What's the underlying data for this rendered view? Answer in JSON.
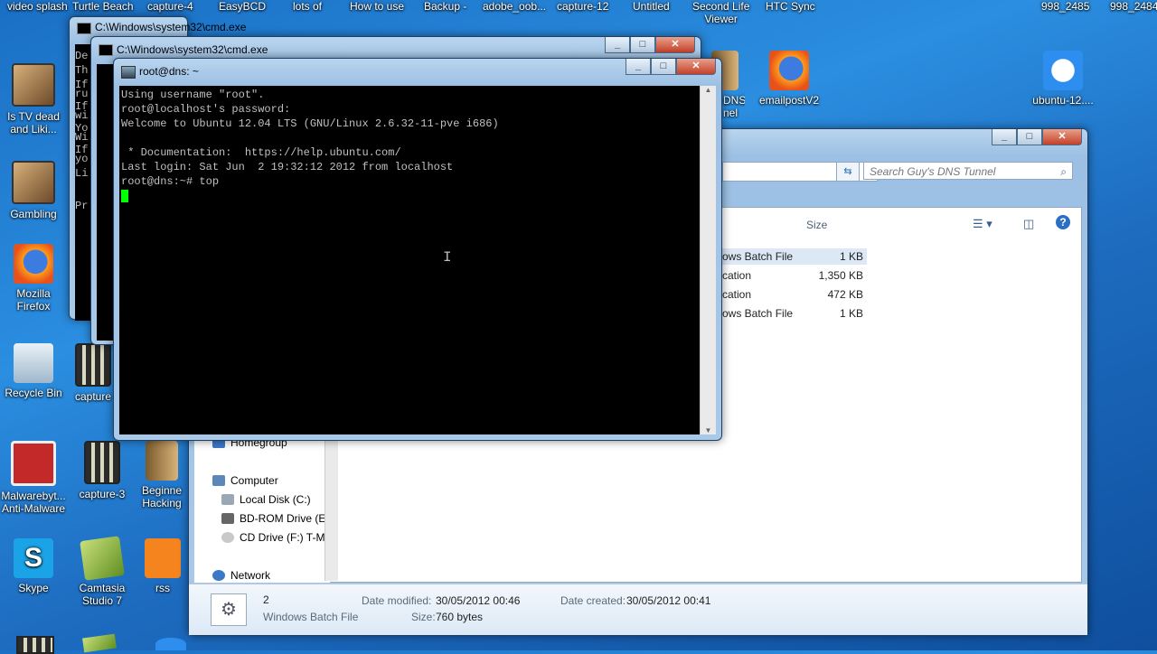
{
  "top_labels": [
    "video splash",
    "Turtle Beach",
    "capture-4",
    "EasyBCD",
    "lots of",
    "How to use",
    "Backup -",
    "adobe_oob...",
    "capture-12",
    "Untitled",
    "Second Life\nViewer",
    "HTC Sync",
    "998_2485",
    "998_2484"
  ],
  "desktop_icons": {
    "tvdead": "Is TV dead\nand Liki...",
    "gambling": "Gambling",
    "firefox": "Mozilla\nFirefox",
    "recycle": "Recycle Bin",
    "capture_a": "capture",
    "malwarebytes": "Malwarebyt...\nAnti-Malware",
    "capture3": "capture-3",
    "beginner": "Beginne\nHacking",
    "skype": "Skype",
    "camtasia": "Camtasia\nStudio 7",
    "rss": "rss",
    "dns": "DNS\nnel",
    "emailpost": "emailpostV2",
    "ubuntu": "ubuntu-12...."
  },
  "cmd_back": {
    "title": "C:\\Windows\\system32\\cmd.exe",
    "lines": [
      "De",
      "Th",
      "If\nru",
      "If\nwi",
      "Yo\nWi",
      "If\nyo",
      "Li",
      "Pr"
    ]
  },
  "cmd_mid": {
    "title": "C:\\Windows\\system32\\cmd.exe"
  },
  "putty": {
    "title": "root@dns: ~",
    "lines": [
      "Using username \"root\".",
      "root@localhost's password:",
      "Welcome to Ubuntu 12.04 LTS (GNU/Linux 2.6.32-11-pve i686)",
      "",
      " * Documentation:  https://help.ubuntu.com/",
      "Last login: Sat Jun  2 19:32:12 2012 from localhost",
      "root@dns:~# top"
    ]
  },
  "explorer": {
    "search_placeholder": "Search Guy's DNS Tunnel",
    "col_size": "Size",
    "files": [
      {
        "type": "ows Batch File",
        "size": "1 KB"
      },
      {
        "type": "cation",
        "size": "1,350 KB"
      },
      {
        "type": "cation",
        "size": "472 KB"
      },
      {
        "type": "ows Batch File",
        "size": "1 KB"
      }
    ],
    "tree": {
      "homegroup": "Homegroup",
      "computer": "Computer",
      "local_disk": "Local Disk (C:)",
      "bdrom": "BD-ROM Drive (E",
      "cd": "CD Drive (F:) T-M",
      "network": "Network"
    },
    "details": {
      "name": "2",
      "type": "Windows Batch File",
      "modified_label": "Date modified:",
      "modified": "30/05/2012 00:46",
      "created_label": "Date created:",
      "created": "30/05/2012 00:41",
      "size_label": "Size:",
      "size": "760 bytes"
    }
  },
  "buttons": {
    "min": "_",
    "max": "□",
    "close": "✕"
  }
}
